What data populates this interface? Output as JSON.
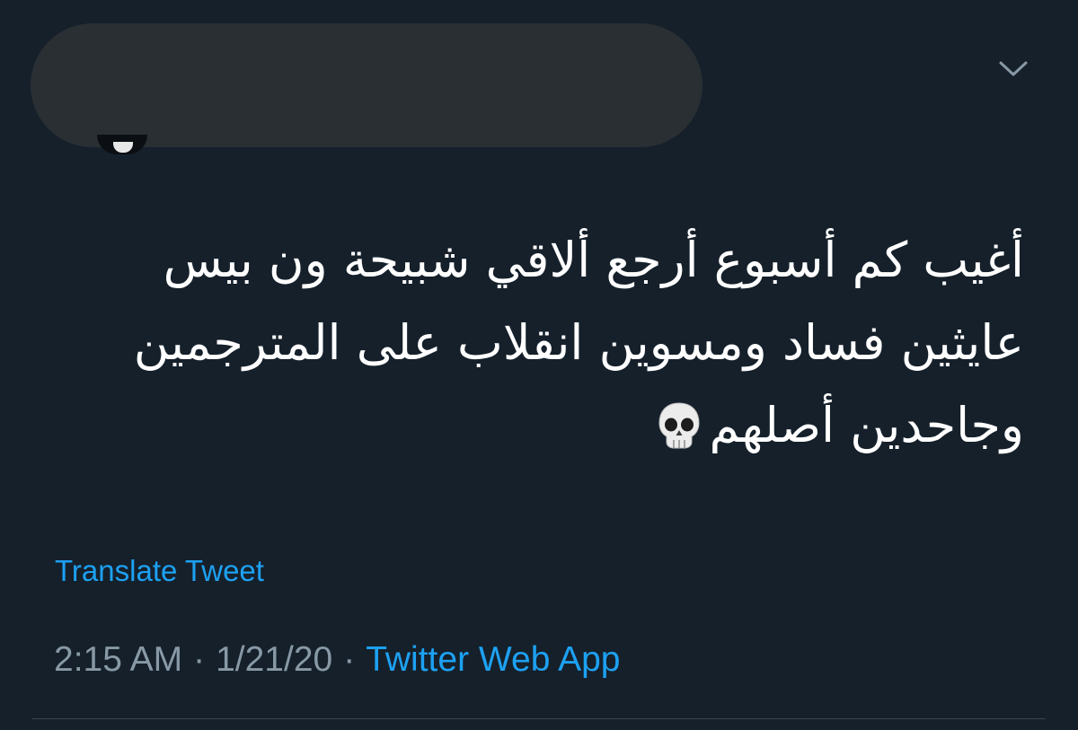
{
  "tweet": {
    "lines": [
      "أغيب كم أسبوع أرجع ألاقي شبيحة ون بيس",
      "عايثين فساد ومسوين انقلاب على المترجمين",
      "وجاحدين أصلهم"
    ],
    "translate_label": "Translate Tweet",
    "time": "2:15 AM",
    "separator": "·",
    "date": "1/21/20",
    "source": "Twitter Web App"
  },
  "icons": {
    "menu": "chevron-down-icon",
    "emoji": "skull-icon"
  },
  "colors": {
    "background": "#15202b",
    "text": "#ffffff",
    "link": "#1da1f2",
    "muted": "#8899a6",
    "redaction": "#2a2f34",
    "divider": "#38444d"
  }
}
